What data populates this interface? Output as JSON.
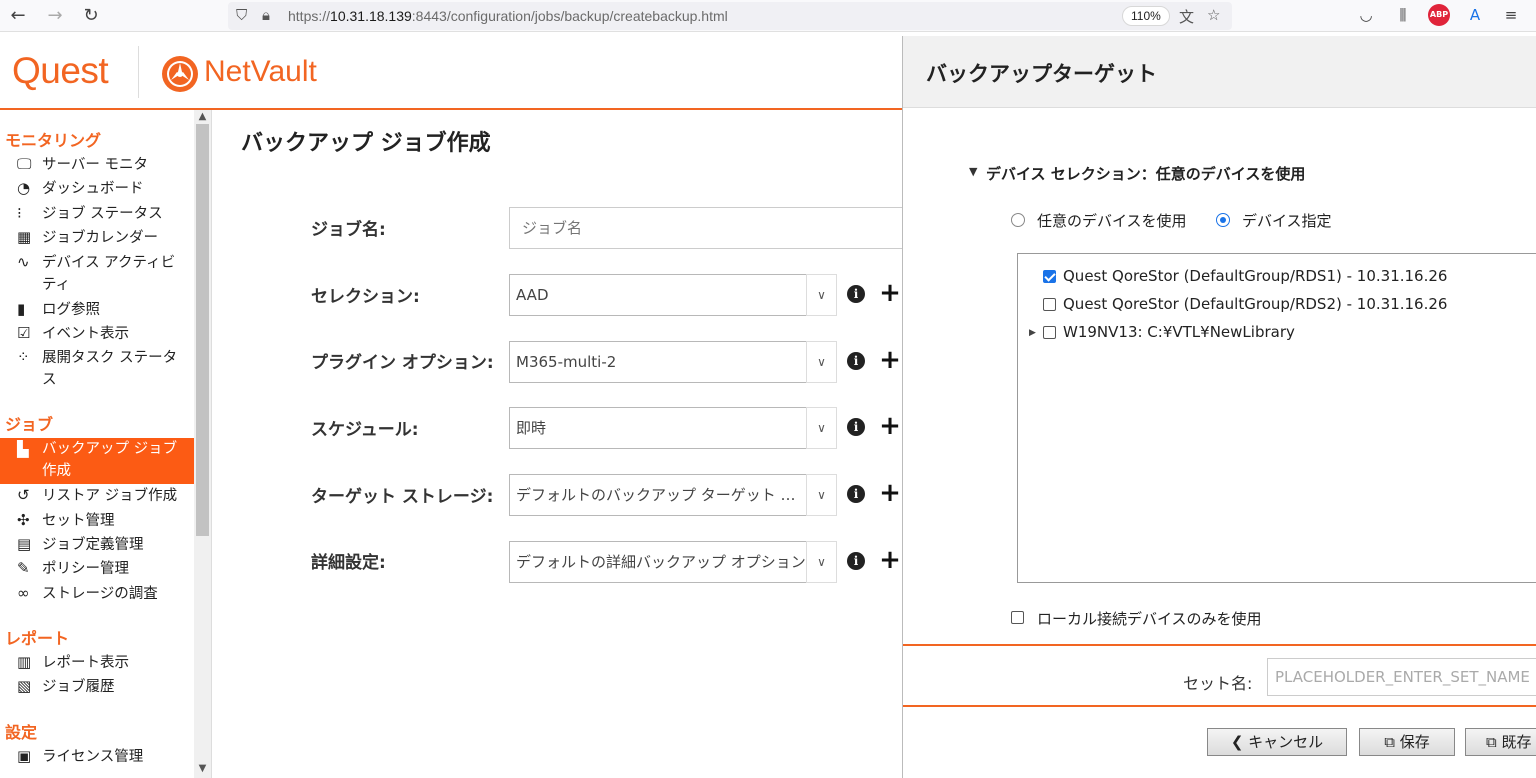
{
  "browser": {
    "url_prefix": "https://",
    "url_host": "10.31.18.139",
    "url_rest": ":8443/configuration/jobs/backup/createbackup.html",
    "zoom": "110%",
    "abp_label": "ABP"
  },
  "app": {
    "brand": "Quest",
    "product": "NetVault",
    "accent_color": "#f26522"
  },
  "sidebar": {
    "sections": [
      {
        "title": "モニタリング",
        "items": [
          {
            "label": "サーバー モニタ",
            "icon": "monitor-icon"
          },
          {
            "label": "ダッシュボード",
            "icon": "gauge-icon"
          },
          {
            "label": "ジョブ ステータス",
            "icon": "traffic-light-icon"
          },
          {
            "label": "ジョブカレンダー",
            "icon": "calendar-icon"
          },
          {
            "label": "デバイス アクティビティ",
            "icon": "activity-icon"
          },
          {
            "label": "ログ参照",
            "icon": "log-icon"
          },
          {
            "label": "イベント表示",
            "icon": "event-icon"
          },
          {
            "label": "展開タスク ステータス",
            "icon": "spinner-icon"
          }
        ]
      },
      {
        "title": "ジョブ",
        "items": [
          {
            "label": "バックアップ ジョブ作成",
            "icon": "backup-icon",
            "active": true
          },
          {
            "label": "リストア ジョブ作成",
            "icon": "restore-icon"
          },
          {
            "label": "セット管理",
            "icon": "puzzle-icon"
          },
          {
            "label": "ジョブ定義管理",
            "icon": "list-icon"
          },
          {
            "label": "ポリシー管理",
            "icon": "policy-icon"
          },
          {
            "label": "ストレージの調査",
            "icon": "binoculars-icon"
          }
        ]
      },
      {
        "title": "レポート",
        "items": [
          {
            "label": "レポート表示",
            "icon": "report-icon"
          },
          {
            "label": "ジョブ履歴",
            "icon": "history-icon"
          }
        ]
      },
      {
        "title": "設定",
        "items": [
          {
            "label": "ライセンス管理",
            "icon": "license-icon"
          }
        ]
      }
    ]
  },
  "main": {
    "title": "バックアップ ジョブ作成",
    "job_name": {
      "label": "ジョブ名:",
      "placeholder": "ジョブ名",
      "value": ""
    },
    "selection": {
      "label": "セレクション:",
      "value": "AAD"
    },
    "plugin_options": {
      "label": "プラグイン オプション:",
      "value": "M365-multi-2"
    },
    "schedule": {
      "label": "スケジュール:",
      "value": "即時"
    },
    "target_storage": {
      "label": "ターゲット ストレージ:",
      "value": "デフォルトのバックアップ ターゲット オプション"
    },
    "advanced": {
      "label": "詳細設定:",
      "value": "デフォルトの詳細バックアップ オプション"
    }
  },
  "panel": {
    "title": "バックアップターゲット",
    "device_selection_title": "デバイス セレクション：任意のデバイスを使用",
    "radio_any": "任意のデバイスを使用",
    "radio_specify": "デバイス指定",
    "radio_selected": "specify",
    "devices": [
      {
        "label": "Quest QoreStor (DefaultGroup/RDS1) - 10.31.16.26",
        "checked": true,
        "expandable": false
      },
      {
        "label": "Quest QoreStor (DefaultGroup/RDS2) - 10.31.16.26",
        "checked": false,
        "expandable": false
      },
      {
        "label": "W19NV13: C:¥VTL¥NewLibrary",
        "checked": false,
        "expandable": true
      }
    ],
    "local_only_label": "ローカル接続デバイスのみを使用",
    "local_only_checked": false,
    "set_name_label": "セット名:",
    "set_name_value": "PLACEHOLDER_ENTER_SET_NAME",
    "cancel_label": "キャンセル",
    "save_label": "保存",
    "existing_label": "既存"
  }
}
